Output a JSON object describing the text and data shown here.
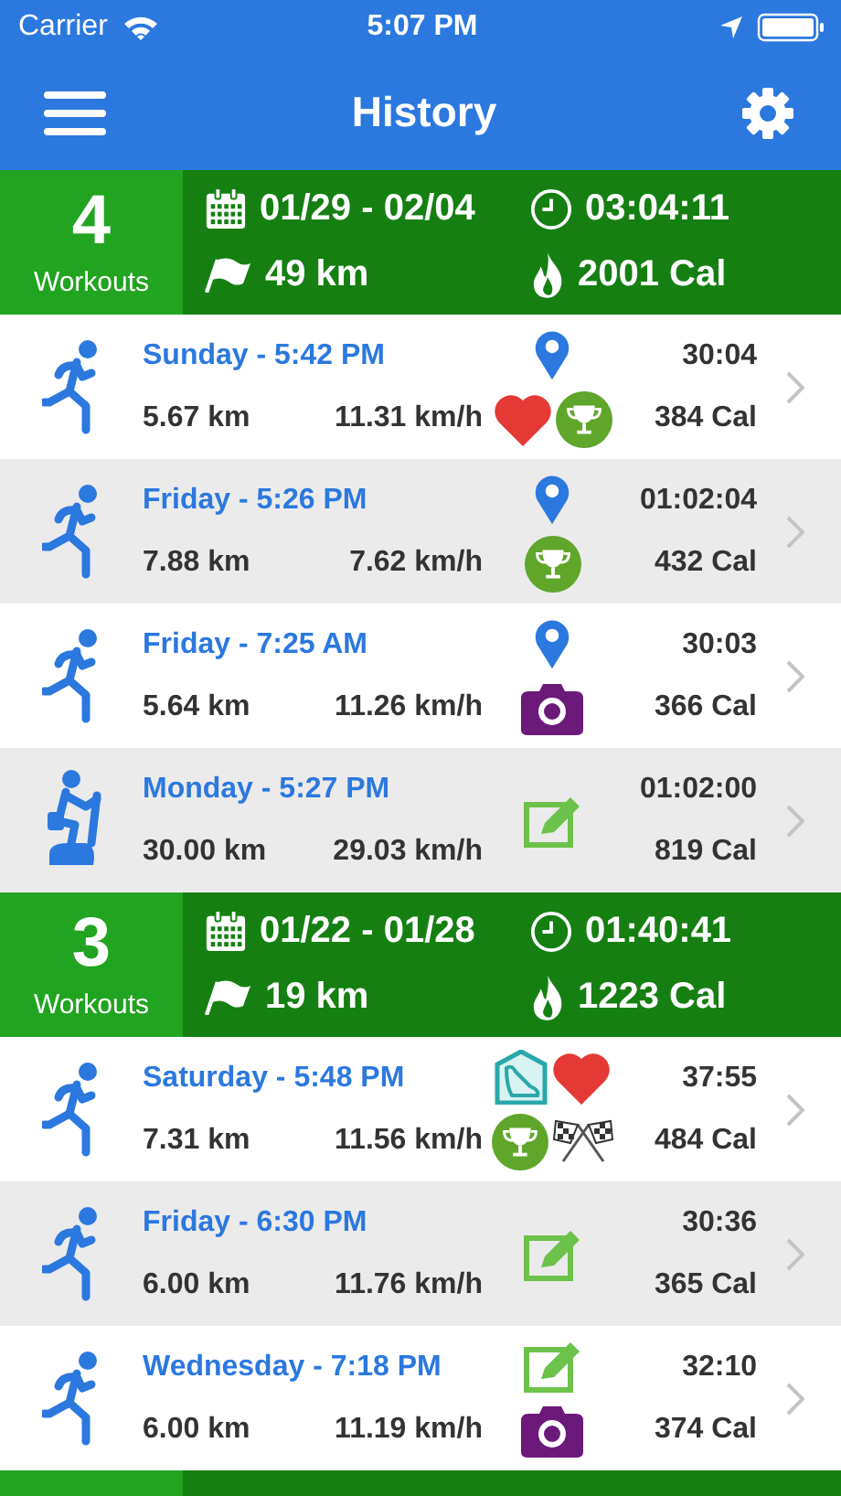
{
  "status_bar": {
    "carrier": "Carrier",
    "time": "5:07 PM"
  },
  "nav": {
    "title": "History"
  },
  "weeks": [
    {
      "count": "4",
      "count_label": "Workouts",
      "dates": "01/29 - 02/04",
      "duration": "03:04:11",
      "distance": "49 km",
      "calories": "2001 Cal",
      "workouts": [
        {
          "kind": "run",
          "title": "Sunday - 5:42 PM",
          "distance": "5.67 km",
          "speed": "11.31 km/h",
          "duration": "30:04",
          "calories": "384 Cal",
          "top_badges": [
            {
              "kind": "pin"
            }
          ],
          "bottom_badges": [
            {
              "kind": "heart"
            },
            {
              "kind": "trophy"
            }
          ]
        },
        {
          "kind": "run",
          "title": "Friday - 5:26 PM",
          "distance": "7.88 km",
          "speed": "7.62 km/h",
          "duration": "01:02:04",
          "calories": "432 Cal",
          "top_badges": [
            {
              "kind": "pin"
            }
          ],
          "bottom_badges": [
            {
              "kind": "trophy"
            }
          ]
        },
        {
          "kind": "run",
          "title": "Friday - 7:25 AM",
          "distance": "5.64 km",
          "speed": "11.26 km/h",
          "duration": "30:03",
          "calories": "366 Cal",
          "top_badges": [
            {
              "kind": "pin"
            }
          ],
          "bottom_badges": [
            {
              "kind": "camera"
            }
          ]
        },
        {
          "kind": "bike",
          "title": "Monday - 5:27 PM",
          "distance": "30.00 km",
          "speed": "29.03 km/h",
          "duration": "01:02:00",
          "calories": "819 Cal",
          "middle_badges": [
            {
              "kind": "note"
            }
          ]
        }
      ]
    },
    {
      "count": "3",
      "count_label": "Workouts",
      "dates": "01/22 - 01/28",
      "duration": "01:40:41",
      "distance": "19 km",
      "calories": "1223 Cal",
      "workouts": [
        {
          "kind": "run",
          "title": "Saturday - 5:48 PM",
          "distance": "7.31 km",
          "speed": "11.56 km/h",
          "duration": "37:55",
          "calories": "484 Cal",
          "top_badges": [
            {
              "kind": "shoe"
            },
            {
              "kind": "heart"
            }
          ],
          "bottom_badges": [
            {
              "kind": "trophy"
            },
            {
              "kind": "flags"
            }
          ]
        },
        {
          "kind": "run",
          "title": "Friday - 6:30 PM",
          "distance": "6.00 km",
          "speed": "11.76 km/h",
          "duration": "30:36",
          "calories": "365 Cal",
          "middle_badges": [
            {
              "kind": "note"
            }
          ]
        },
        {
          "kind": "run",
          "title": "Wednesday - 7:18 PM",
          "distance": "6.00 km",
          "speed": "11.19 km/h",
          "duration": "32:10",
          "calories": "374 Cal",
          "top_badges": [
            {
              "kind": "note"
            }
          ],
          "bottom_badges": [
            {
              "kind": "camera"
            }
          ]
        }
      ]
    }
  ]
}
